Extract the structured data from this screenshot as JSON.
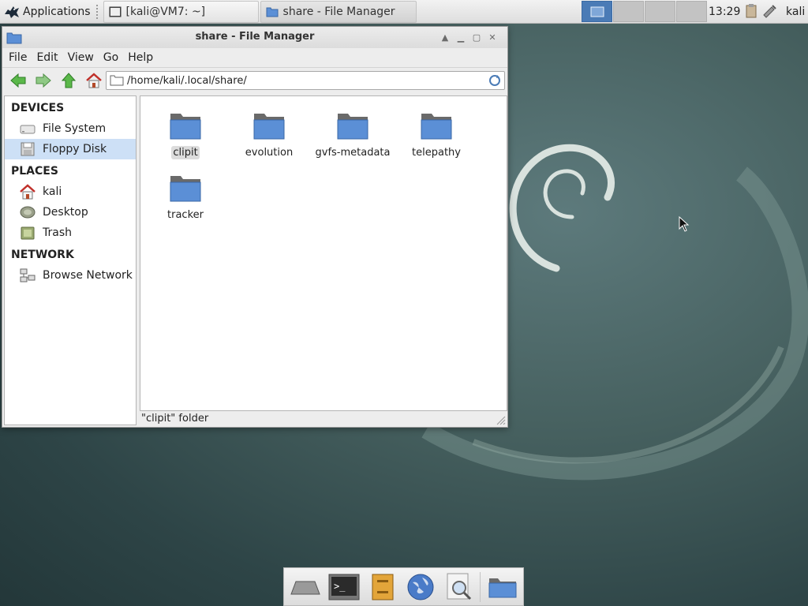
{
  "top_panel": {
    "apps_label": "Applications",
    "tasks": [
      {
        "label": "[kali@VM7: ~]"
      },
      {
        "label": "share - File Manager"
      }
    ],
    "clock": "13:29",
    "user": "kali"
  },
  "window": {
    "title": "share - File Manager",
    "menu": [
      "File",
      "Edit",
      "View",
      "Go",
      "Help"
    ],
    "path": "/home/kali/.local/share/"
  },
  "sidebar": {
    "sections": [
      {
        "title": "DEVICES",
        "items": [
          {
            "label": "File System",
            "icon": "drive-icon"
          },
          {
            "label": "Floppy Disk",
            "icon": "floppy-icon",
            "selected": true
          }
        ]
      },
      {
        "title": "PLACES",
        "items": [
          {
            "label": "kali",
            "icon": "home-icon"
          },
          {
            "label": "Desktop",
            "icon": "desktop-icon"
          },
          {
            "label": "Trash",
            "icon": "trash-icon"
          }
        ]
      },
      {
        "title": "NETWORK",
        "items": [
          {
            "label": "Browse Network",
            "icon": "network-icon"
          }
        ]
      }
    ]
  },
  "files": [
    {
      "name": "clipit",
      "selected": true
    },
    {
      "name": "evolution"
    },
    {
      "name": "gvfs-metadata"
    },
    {
      "name": "telepathy"
    },
    {
      "name": "tracker"
    }
  ],
  "status": "\"clipit\" folder",
  "colors": {
    "selection": "#cde0f6",
    "folder_blue": "#5b8fd6",
    "workspace_active": "#4a7bb6"
  }
}
